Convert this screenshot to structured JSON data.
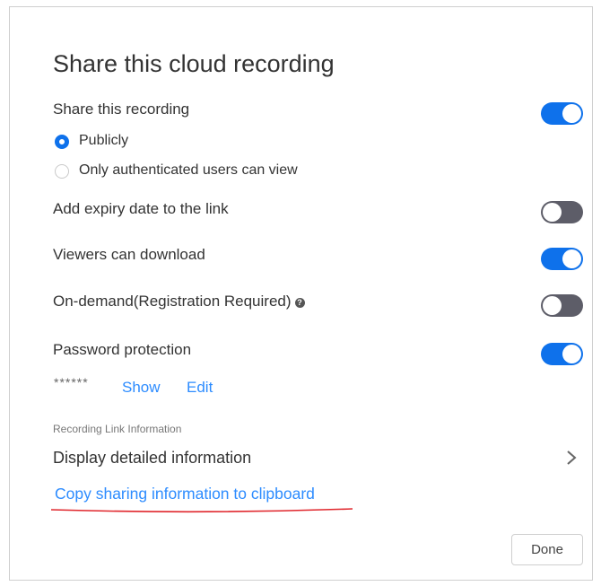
{
  "dialog": {
    "title": "Share this cloud recording"
  },
  "share": {
    "label": "Share this recording",
    "toggle_on": true,
    "options": [
      {
        "label": "Publicly",
        "selected": true
      },
      {
        "label": "Only authenticated users can view",
        "selected": false
      }
    ]
  },
  "expiry": {
    "label": "Add expiry date to the link",
    "toggle_on": false
  },
  "download": {
    "label": "Viewers can download",
    "toggle_on": true
  },
  "on_demand": {
    "label": "On-demand(Registration Required)",
    "toggle_on": false,
    "help_icon": "question-circle-icon"
  },
  "password": {
    "label": "Password protection",
    "toggle_on": true,
    "masked_value": "******",
    "show_label": "Show",
    "edit_label": "Edit"
  },
  "link_info": {
    "heading": "Recording Link Information",
    "detail_label": "Display detailed information",
    "detail_icon": "chevron-right-icon",
    "copy_label": "Copy sharing information to clipboard"
  },
  "footer": {
    "done_label": "Done"
  },
  "colors": {
    "accent": "#0e71eb",
    "toggle_off": "#5d5d68",
    "link": "#2d8cff",
    "annotation_underline": "#e0262c"
  }
}
